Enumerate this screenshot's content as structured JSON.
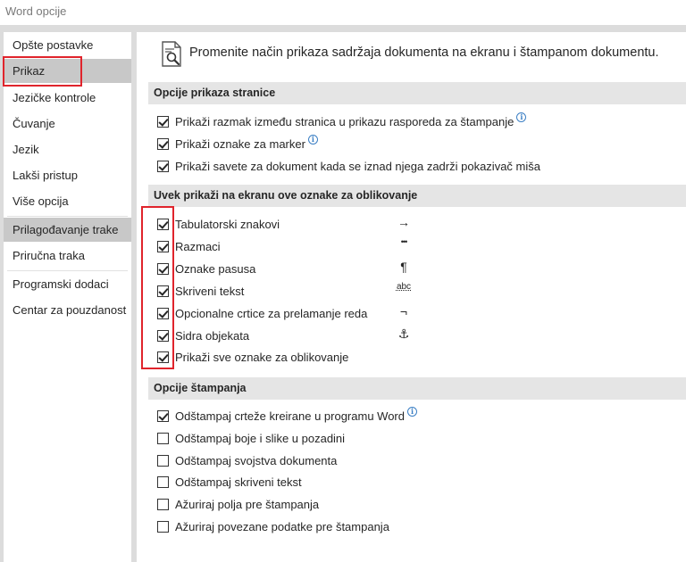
{
  "window": {
    "title": "Word opcije"
  },
  "sidebar": {
    "items": [
      {
        "label": "Opšte postavke"
      },
      {
        "label": "Prikaz"
      },
      {
        "label": "Jezičke kontrole"
      },
      {
        "label": "Čuvanje"
      },
      {
        "label": "Jezik"
      },
      {
        "label": "Lakši pristup"
      },
      {
        "label": "Više opcija"
      },
      {
        "label": "Prilagođavanje trake"
      },
      {
        "label": "Priručna traka"
      },
      {
        "label": "Programski dodaci"
      },
      {
        "label": "Centar za pouzdanost"
      }
    ],
    "selected": "Prikaz"
  },
  "header": {
    "text": "Promenite način prikaza sadržaja dokumenta na ekranu i štampanom dokumentu."
  },
  "sections": {
    "page_display": {
      "title": "Opcije prikaza stranice",
      "options": [
        {
          "label": "Prikaži razmak između stranica u prikazu rasporeda za štampanje",
          "checked": true,
          "info": true
        },
        {
          "label": "Prikaži oznake za marker",
          "checked": true,
          "info": true
        },
        {
          "label": "Prikaži savete za dokument kada se iznad njega zadrži pokazivač miša",
          "checked": true,
          "info": false
        }
      ]
    },
    "formatting_marks": {
      "title": "Uvek prikaži na ekranu ove oznake za oblikovanje",
      "options": [
        {
          "label": "Tabulatorski znakovi",
          "checked": true,
          "symbol": "→"
        },
        {
          "label": "Razmaci",
          "checked": true,
          "symbol": "•••"
        },
        {
          "label": "Oznake pasusa",
          "checked": true,
          "symbol": "¶"
        },
        {
          "label": "Skriveni tekst",
          "checked": true,
          "symbol": "abc"
        },
        {
          "label": "Opcionalne crtice za prelamanje reda",
          "checked": true,
          "symbol": "¬"
        },
        {
          "label": "Sidra objekata",
          "checked": true,
          "symbol": "⚓"
        },
        {
          "label": "Prikaži sve oznake za oblikovanje",
          "checked": true,
          "symbol": ""
        }
      ]
    },
    "printing": {
      "title": "Opcije štampanja",
      "options": [
        {
          "label": "Odštampaj crteže kreirane u programu Word",
          "checked": true,
          "info": true
        },
        {
          "label": "Odštampaj boje i slike u pozadini",
          "checked": false,
          "info": false
        },
        {
          "label": "Odštampaj svojstva dokumenta",
          "checked": false,
          "info": false
        },
        {
          "label": "Odštampaj skriveni tekst",
          "checked": false,
          "info": false
        },
        {
          "label": "Ažuriraj polja pre štampanja",
          "checked": false,
          "info": false
        },
        {
          "label": "Ažuriraj povezane podatke pre štampanja",
          "checked": false,
          "info": false
        }
      ]
    }
  },
  "icons": {
    "header": "document-magnifier-icon",
    "info": "info-icon",
    "info_glyph": "i"
  },
  "colors": {
    "highlight": "#e0242c",
    "selected_nav": "#c8c8c8",
    "section_header": "#e5e5e5",
    "info": "#3b7fc4"
  }
}
